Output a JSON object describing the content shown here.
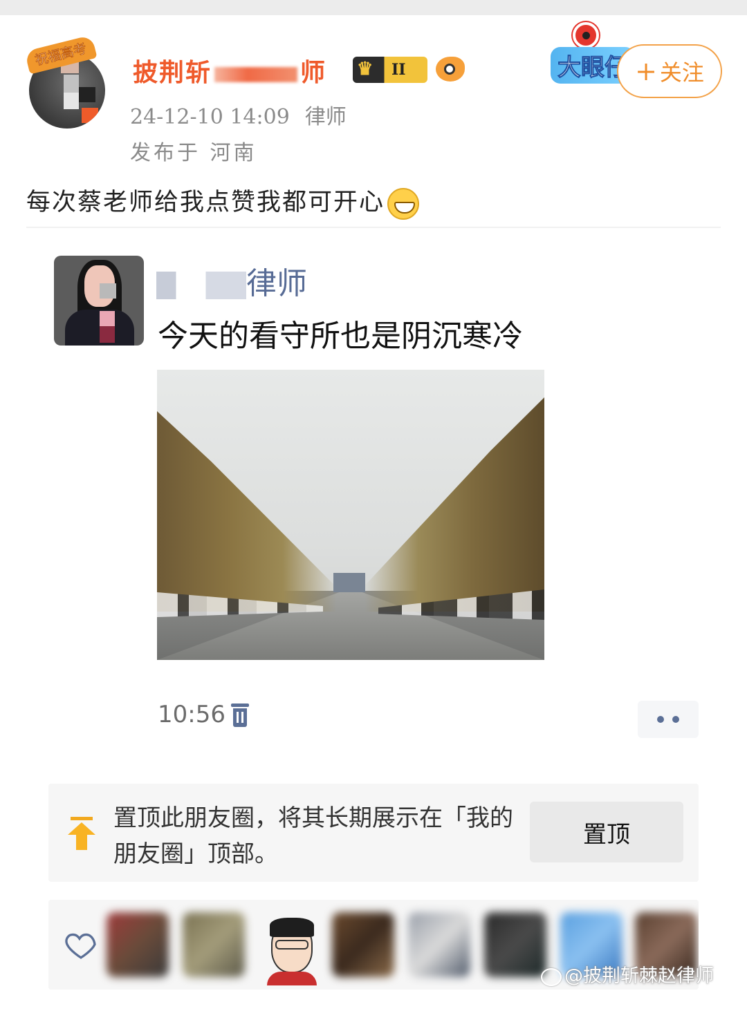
{
  "weibo_post": {
    "avatar_ring_text": "祝福高考",
    "username": "披荆斩棘赵律师",
    "username_visible_start": "披荆斩",
    "username_visible_end": "师",
    "member_level": "II",
    "timestamp": "24-12-10 14:09",
    "source": "律师",
    "location": "发布于 河南",
    "follow_label": "关注",
    "follow_plus": "+",
    "big_eye_tag": "大眼仔",
    "text": "每次蔡老师给我点赞我都可开心",
    "emoji": "grinning-face-icon"
  },
  "wechat_moment": {
    "author_visible": "律师",
    "text": "今天的看守所也是阴沉寒冷",
    "photo_description_icon": "tree-lined-road-photo",
    "time": "10:56",
    "pin_card": {
      "text": "置顶此朋友圈，将其长期展示在「我的朋友圈」顶部。",
      "button_label": "置顶"
    }
  },
  "watermark": "@披荆斩棘赵律师",
  "colors": {
    "weibo_name": "#ef5a2b",
    "follow_border": "#f3a147",
    "wechat_name": "#576b95",
    "meta_gray": "#8a8a8a"
  }
}
